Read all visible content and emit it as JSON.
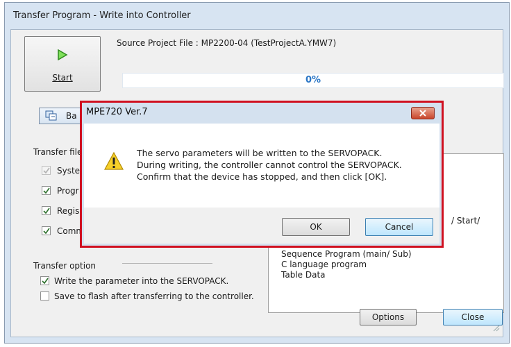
{
  "window": {
    "title": "Transfer Program - Write into Controller"
  },
  "start_button": {
    "label": "Start"
  },
  "source": {
    "text": "Source Project File : MP2200-04    (TestProjectA.YMW7)"
  },
  "progress": {
    "text": "0%",
    "value": 0
  },
  "backup_button": {
    "label": "Ba"
  },
  "transfer_files": {
    "heading": "Transfer file",
    "items": [
      {
        "label": "Syste",
        "checked": true,
        "disabled": true
      },
      {
        "label": "Progr",
        "checked": true,
        "disabled": false
      },
      {
        "label": "Regis",
        "checked": true,
        "disabled": false
      },
      {
        "label": "Comm",
        "checked": true,
        "disabled": false
      }
    ]
  },
  "group_panel": {
    "start_fragment": "/ Start/",
    "lines": [
      "Sequence Program (main/ Sub)",
      "C language program",
      "Table Data"
    ]
  },
  "transfer_option": {
    "heading": "Transfer option",
    "items": [
      {
        "label": "Write the parameter into the SERVOPACK.",
        "checked": true
      },
      {
        "label": "Save to flash after transferring to the controller.",
        "checked": false
      }
    ]
  },
  "buttons": {
    "options": "Options",
    "close": "Close"
  },
  "dialog": {
    "title": "MPE720 Ver.7",
    "message_lines": [
      "The servo parameters will be written to the SERVOPACK.",
      "During writing, the controller cannot control the SERVOPACK.",
      "Confirm that the device has stopped, and then click [OK]."
    ],
    "ok": "OK",
    "cancel": "Cancel",
    "icon": "warning-icon"
  },
  "colors": {
    "highlight_border": "#d01020",
    "progress_text": "#2a76c6"
  }
}
